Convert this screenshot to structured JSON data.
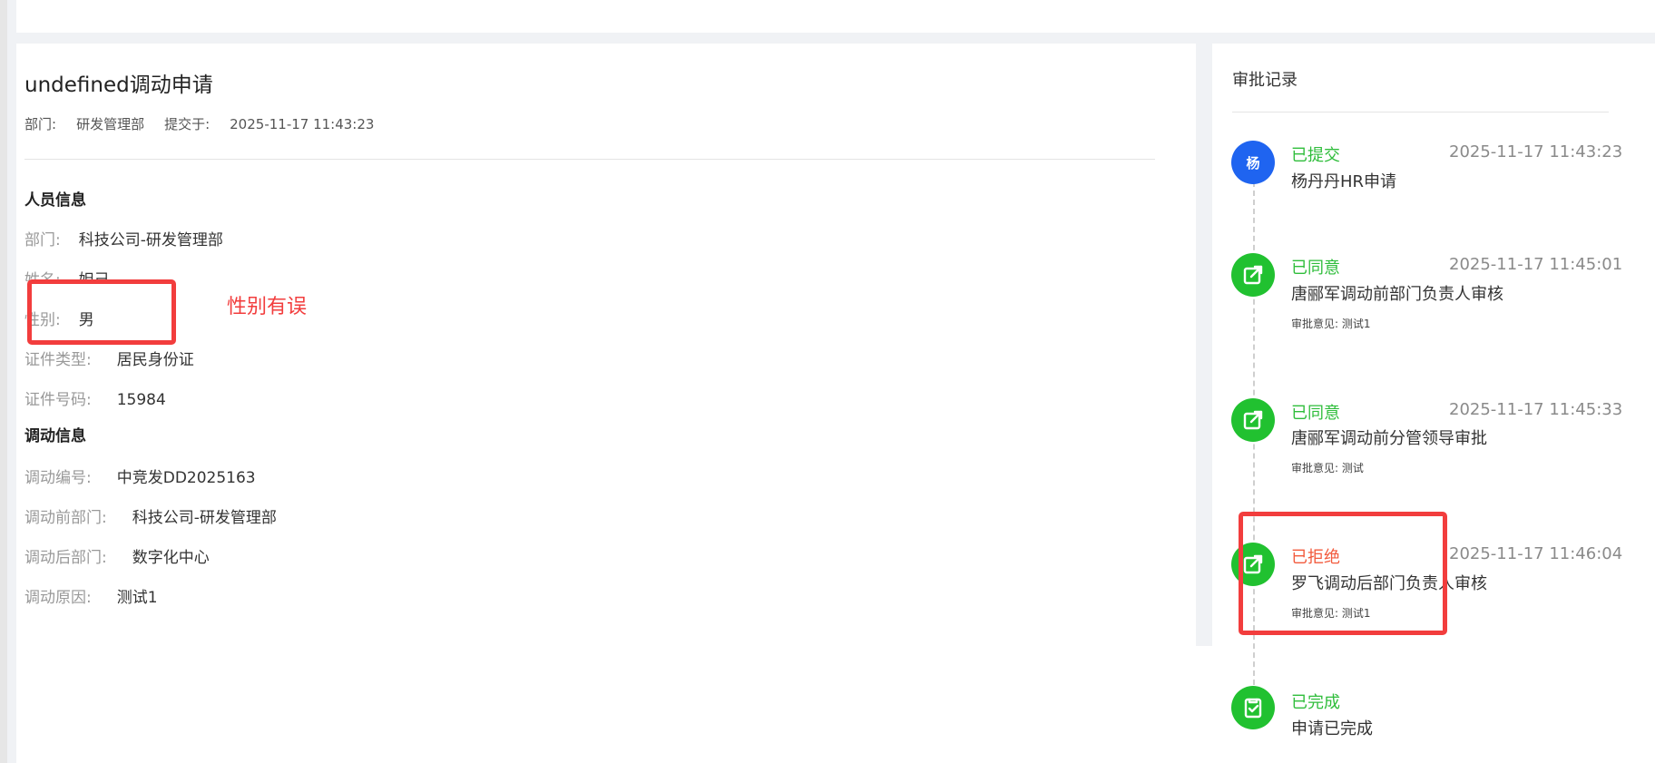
{
  "breadcrumb": "",
  "application": {
    "title": "undefined调动申请",
    "department_label": "部门:",
    "department_value": "研发管理部",
    "submitted_label": "提交于:",
    "submitted_value": "2025-11-17 11:43:23"
  },
  "personnel": {
    "section_title": "人员信息",
    "fields": [
      {
        "label": "部门:",
        "value": "科技公司-研发管理部"
      },
      {
        "label": "姓名:",
        "value": "妲己"
      },
      {
        "label": "性别:",
        "value": "男"
      },
      {
        "label": "证件类型:",
        "value": "居民身份证"
      },
      {
        "label": "证件号码:",
        "value": "15984"
      }
    ]
  },
  "transfer": {
    "section_title": "调动信息",
    "fields": [
      {
        "label": "调动编号:",
        "value": "中竞发DD2025163"
      },
      {
        "label": "调动前部门:",
        "value": "科技公司-研发管理部"
      },
      {
        "label": "调动后部门:",
        "value": "数字化中心"
      },
      {
        "label": "调动原因:",
        "value": "测试1"
      }
    ]
  },
  "annotation": {
    "text": "性别有误",
    "color": "#f23d3d"
  },
  "approval": {
    "title": "审批记录",
    "records": [
      {
        "avatar": "杨",
        "icon": "user-avatar",
        "status": "已提交",
        "status_type": "ok",
        "time": "2025-11-17 11:43:23",
        "description": "杨丹丹HR申请",
        "opinion": ""
      },
      {
        "avatar": "",
        "icon": "share-icon",
        "status": "已同意",
        "status_type": "ok",
        "time": "2025-11-17 11:45:01",
        "description": "唐郦军调动前部门负责人审核",
        "opinion": "审批意见: 测试1"
      },
      {
        "avatar": "",
        "icon": "share-icon",
        "status": "已同意",
        "status_type": "ok",
        "time": "2025-11-17 11:45:33",
        "description": "唐郦军调动前分管领导审批",
        "opinion": "审批意见: 测试"
      },
      {
        "avatar": "",
        "icon": "share-icon",
        "status": "已拒绝",
        "status_type": "bad",
        "time": "2025-11-17 11:46:04",
        "description": "罗飞调动后部门负责人审核",
        "opinion": "审批意见: 测试1"
      },
      {
        "avatar": "",
        "icon": "checklist-icon",
        "status": "已完成",
        "status_type": "ok",
        "time": "",
        "description": "申请已完成",
        "opinion": ""
      }
    ]
  },
  "colors": {
    "accent_blue": "#1f64f0",
    "success_green": "#21c130",
    "reject_red": "#f25a3c"
  }
}
